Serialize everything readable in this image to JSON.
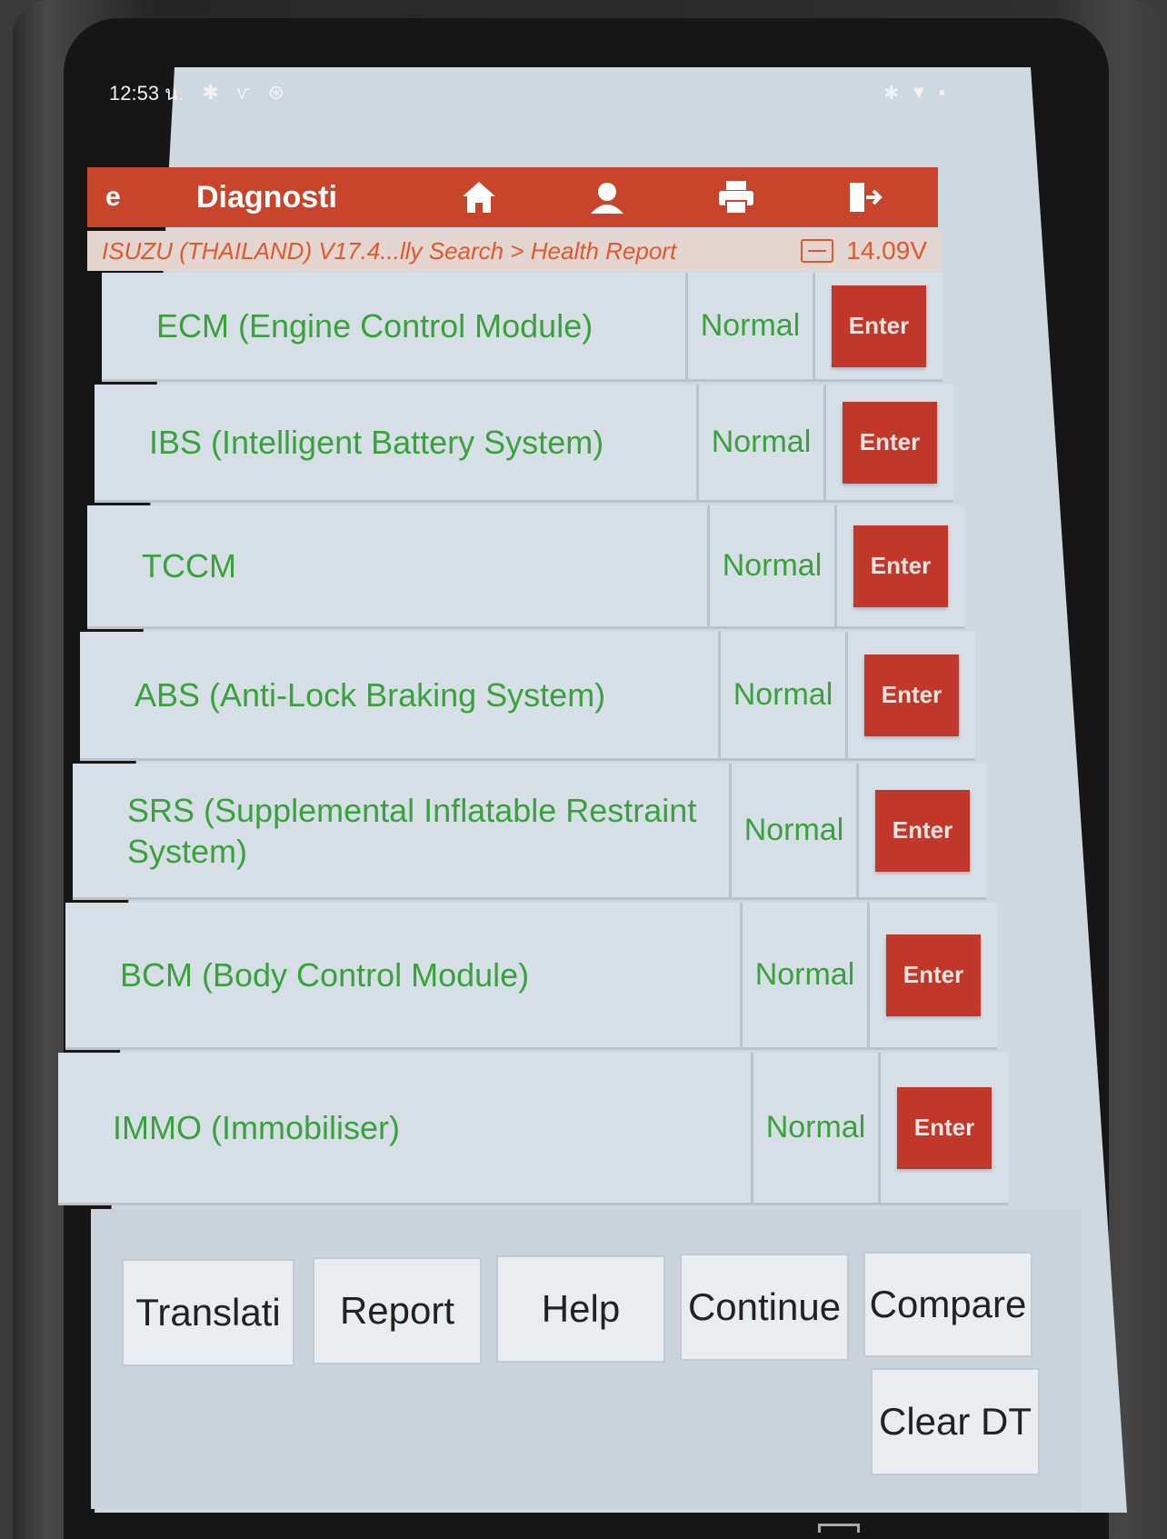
{
  "status_bar": {
    "time": "12:53 น."
  },
  "title_bar": {
    "back_label": "e",
    "title": "Diagnosti",
    "icons": [
      "home-icon",
      "user-icon",
      "print-icon",
      "exit-icon"
    ]
  },
  "breadcrumb": {
    "path": "ISUZU (THAILAND) V17.4...lly Search > Health Report",
    "voltage": "14.09V"
  },
  "modules": [
    {
      "name": "ECM (Engine Control Module)",
      "status": "Normal",
      "action": "Enter"
    },
    {
      "name": "IBS (Intelligent Battery System)",
      "status": "Normal",
      "action": "Enter"
    },
    {
      "name": "TCCM",
      "status": "Normal",
      "action": "Enter"
    },
    {
      "name": "ABS (Anti-Lock Braking System)",
      "status": "Normal",
      "action": "Enter"
    },
    {
      "name": "SRS (Supplemental Inflatable Restraint System)",
      "status": "Normal",
      "action": "Enter"
    },
    {
      "name": "BCM (Body Control Module)",
      "status": "Normal",
      "action": "Enter"
    },
    {
      "name": "IMMO (Immobiliser)",
      "status": "Normal",
      "action": "Enter"
    }
  ],
  "bottom_buttons": {
    "translation": "Translati",
    "report": "Report",
    "help": "Help",
    "continue": "Continue",
    "compare": "Compare",
    "clear_dtc": "Clear DT"
  },
  "colors": {
    "accent": "#c8452c",
    "enter_button": "#c1372a",
    "status_text": "#3aa23d",
    "breadcrumb_text": "#e4582b"
  }
}
